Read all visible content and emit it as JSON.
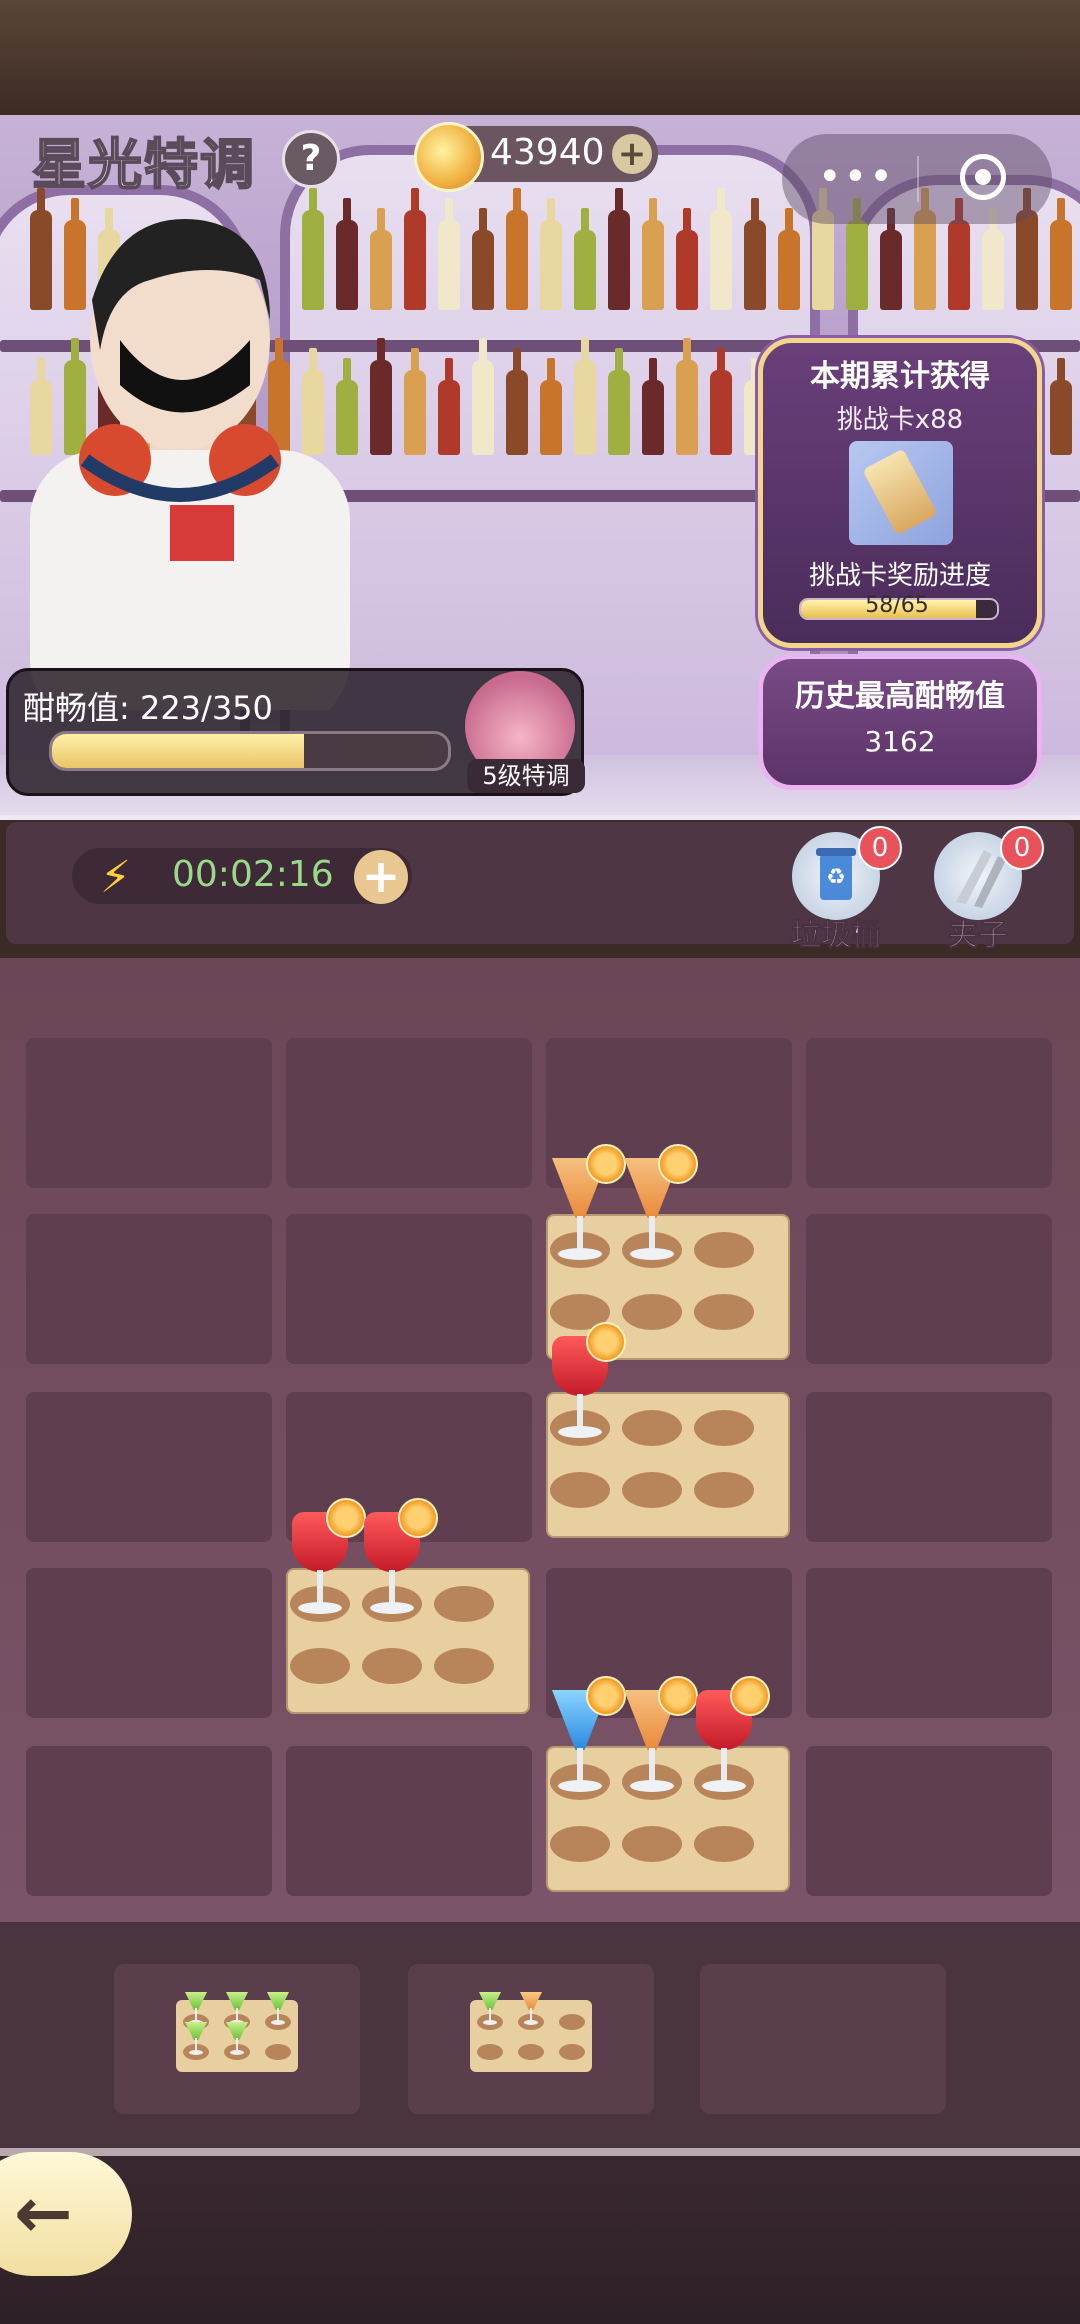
{
  "header": {
    "title": "星光特调",
    "help_label": "?",
    "coins": "43940",
    "coin_plus": "+",
    "menu_dots": "•••"
  },
  "reward_panel": {
    "title": "本期累计获得",
    "item": "挑战卡x88",
    "progress_label": "挑战卡奖励进度",
    "progress_text": "58/65",
    "progress_fraction": 0.892
  },
  "history": {
    "title": "历史最高酣畅值",
    "value": "3162"
  },
  "meter": {
    "label": "酣畅值: 223/350",
    "fraction": 0.637,
    "badge": "5级特调"
  },
  "controls": {
    "timer": "00:02:16",
    "timer_plus": "+",
    "trash_label": "垃圾桶",
    "trash_count": "0",
    "clip_label": "夹子",
    "clip_count": "0"
  },
  "board": {
    "rows": 5,
    "cols": 4,
    "trays": [
      {
        "row": 1,
        "col": 2,
        "glasses": [
          "orange",
          "orange"
        ]
      },
      {
        "row": 2,
        "col": 2,
        "glasses": [
          "red"
        ]
      },
      {
        "row": 3,
        "col": 1,
        "glasses": [
          "red",
          "red"
        ]
      },
      {
        "row": 4,
        "col": 2,
        "glasses": [
          "blue",
          "orange",
          "red"
        ]
      }
    ]
  },
  "pending": {
    "slots": [
      {
        "glasses": [
          "green",
          "green",
          "green",
          "green",
          "green"
        ]
      },
      {
        "glasses": [
          "green",
          "orange"
        ]
      },
      {
        "glasses": []
      }
    ]
  },
  "icons": {
    "coin": "coin-icon",
    "bolt": "lightning-icon",
    "trash": "recycle-bin-icon",
    "clip": "tongs-icon",
    "back": "back-arrow-icon",
    "target": "target-icon"
  },
  "colors": {
    "meter_fill": "#eac468",
    "badge_red": "#e8525a",
    "timer_text": "#9ad88a",
    "tray": "#e8cfa0"
  }
}
